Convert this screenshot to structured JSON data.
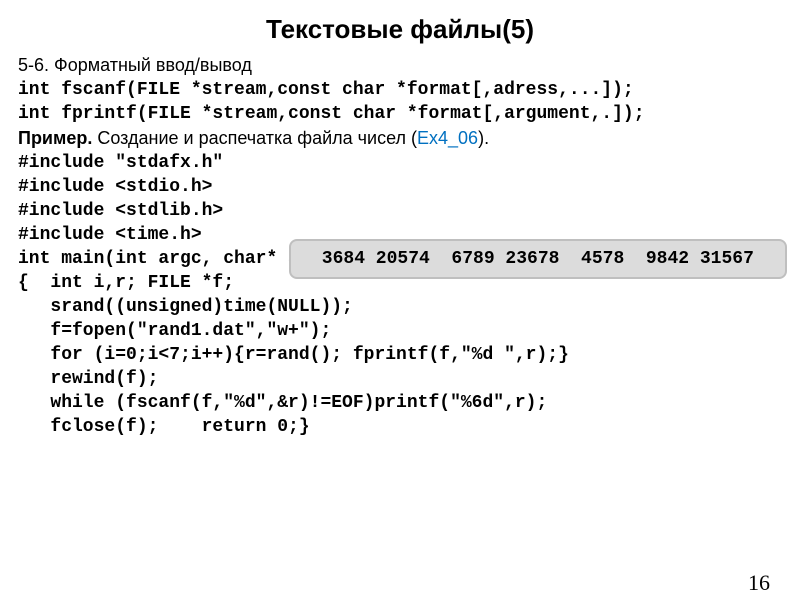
{
  "title": "Текстовые файлы(5)",
  "section_heading": "5-6. Форматный ввод/вывод",
  "proto1": "int fscanf(FILE *stream,const char *format[,adress,...]);",
  "proto2": "int fprintf(FILE *stream,const char *format[,argument,.]);",
  "example": {
    "label": "Пример.",
    "text": " Создание и распечатка  файла чисел (",
    "link": "Ex4_06",
    "after": ")."
  },
  "code": {
    "l1": "#include \"stdafx.h\"",
    "l2": "#include <stdio.h>",
    "l3": "#include <stdlib.h>",
    "l4": "#include <time.h>",
    "l5": "int main(int argc, char* argv[])",
    "l6": "{  int i,r; FILE *f;",
    "l7": "   srand((unsigned)time(NULL));",
    "l8": "   f=fopen(\"rand1.dat\",\"w+\");",
    "l9": "   for (i=0;i<7;i++){r=rand(); fprintf(f,\"%d \",r);}",
    "l10": "   rewind(f);",
    "l11": "   while (fscanf(f,\"%d\",&r)!=EOF)printf(\"%6d\",r);",
    "l12": "   fclose(f);    return 0;}"
  },
  "output": " 3684 20574  6789 23678  4578  9842 31567",
  "page_number": "16"
}
